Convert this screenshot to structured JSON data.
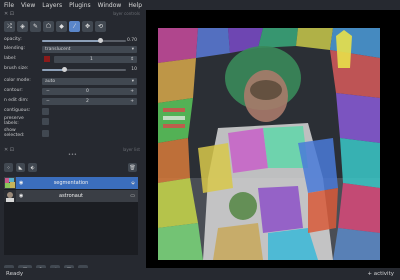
{
  "menubar": [
    "File",
    "View",
    "Layers",
    "Plugins",
    "Window",
    "Help"
  ],
  "controls_panel": {
    "title": "layer controls",
    "rows": [
      {
        "label": "opacity:",
        "value": "0.70",
        "fraction": 0.7
      },
      {
        "label": "blending:",
        "value": "translucent"
      },
      {
        "label": "label:",
        "value": "1"
      },
      {
        "label": "brush size:",
        "value": "10",
        "fraction": 0.25
      },
      {
        "label": "color mode:",
        "value": "auto"
      },
      {
        "label": "contour:",
        "value": "0"
      },
      {
        "label": "n edit dim:",
        "value": "2"
      },
      {
        "label": "contiguous:"
      },
      {
        "label": "preserve labels:"
      },
      {
        "label": "show selected:"
      }
    ]
  },
  "layer_list_title": "layer list",
  "layers": [
    {
      "name": "segmentation",
      "selected": true,
      "kind": "labels"
    },
    {
      "name": "astronaut",
      "selected": false,
      "kind": "image"
    }
  ],
  "status": {
    "left": "Ready",
    "right": "+ activity"
  },
  "colors": {
    "bg": "#262930",
    "accent": "#3b6ebd",
    "widget": "#414851"
  }
}
